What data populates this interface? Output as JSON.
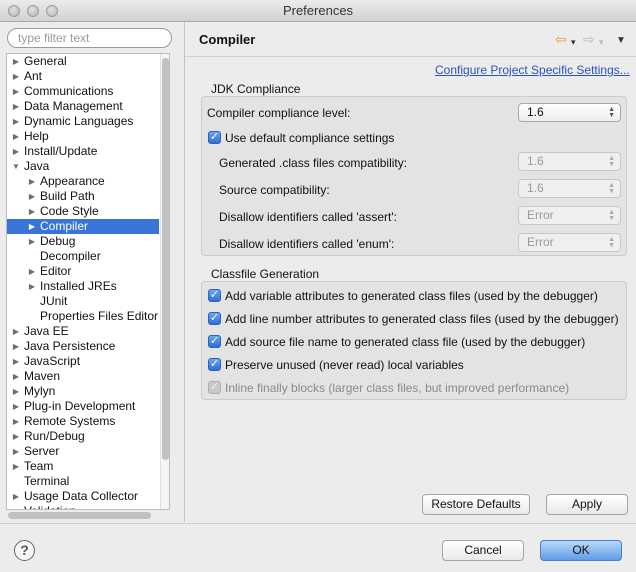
{
  "window": {
    "title": "Preferences"
  },
  "filter": {
    "placeholder": "type filter text"
  },
  "tree": {
    "items": [
      {
        "label": "General",
        "level": 0,
        "expand": "collapsed"
      },
      {
        "label": "Ant",
        "level": 0,
        "expand": "collapsed"
      },
      {
        "label": "Communications",
        "level": 0,
        "expand": "collapsed"
      },
      {
        "label": "Data Management",
        "level": 0,
        "expand": "collapsed"
      },
      {
        "label": "Dynamic Languages",
        "level": 0,
        "expand": "collapsed"
      },
      {
        "label": "Help",
        "level": 0,
        "expand": "collapsed"
      },
      {
        "label": "Install/Update",
        "level": 0,
        "expand": "collapsed"
      },
      {
        "label": "Java",
        "level": 0,
        "expand": "expanded"
      },
      {
        "label": "Appearance",
        "level": 1,
        "expand": "collapsed"
      },
      {
        "label": "Build Path",
        "level": 1,
        "expand": "collapsed"
      },
      {
        "label": "Code Style",
        "level": 1,
        "expand": "collapsed"
      },
      {
        "label": "Compiler",
        "level": 1,
        "expand": "collapsed",
        "selected": true
      },
      {
        "label": "Debug",
        "level": 1,
        "expand": "collapsed"
      },
      {
        "label": "Decompiler",
        "level": 1,
        "expand": "none"
      },
      {
        "label": "Editor",
        "level": 1,
        "expand": "collapsed"
      },
      {
        "label": "Installed JREs",
        "level": 1,
        "expand": "collapsed"
      },
      {
        "label": "JUnit",
        "level": 1,
        "expand": "none"
      },
      {
        "label": "Properties Files Editor",
        "level": 1,
        "expand": "none"
      },
      {
        "label": "Java EE",
        "level": 0,
        "expand": "collapsed"
      },
      {
        "label": "Java Persistence",
        "level": 0,
        "expand": "collapsed"
      },
      {
        "label": "JavaScript",
        "level": 0,
        "expand": "collapsed"
      },
      {
        "label": "Maven",
        "level": 0,
        "expand": "collapsed"
      },
      {
        "label": "Mylyn",
        "level": 0,
        "expand": "collapsed"
      },
      {
        "label": "Plug-in Development",
        "level": 0,
        "expand": "collapsed"
      },
      {
        "label": "Remote Systems",
        "level": 0,
        "expand": "collapsed"
      },
      {
        "label": "Run/Debug",
        "level": 0,
        "expand": "collapsed"
      },
      {
        "label": "Server",
        "level": 0,
        "expand": "collapsed"
      },
      {
        "label": "Team",
        "level": 0,
        "expand": "collapsed"
      },
      {
        "label": "Terminal",
        "level": 0,
        "expand": "none"
      },
      {
        "label": "Usage Data Collector",
        "level": 0,
        "expand": "collapsed"
      },
      {
        "label": "Validation",
        "level": 0,
        "expand": "none"
      }
    ]
  },
  "page": {
    "title": "Compiler",
    "config_link": "Configure Project Specific Settings..."
  },
  "jdk": {
    "group_title": "JDK Compliance",
    "compliance_label": "Compiler compliance level:",
    "compliance_value": "1.6",
    "default_settings_label": "Use default compliance settings",
    "default_settings_checked": true,
    "generated_label": "Generated .class files compatibility:",
    "generated_value": "1.6",
    "source_label": "Source compatibility:",
    "source_value": "1.6",
    "assert_label": "Disallow identifiers called 'assert':",
    "assert_value": "Error",
    "enum_label": "Disallow identifiers called 'enum':",
    "enum_value": "Error"
  },
  "classfile": {
    "group_title": "Classfile Generation",
    "options": [
      {
        "label": "Add variable attributes to generated class files (used by the debugger)",
        "checked": true,
        "enabled": true
      },
      {
        "label": "Add line number attributes to generated class files (used by the debugger)",
        "checked": true,
        "enabled": true
      },
      {
        "label": "Add source file name to generated class file (used by the debugger)",
        "checked": true,
        "enabled": true
      },
      {
        "label": "Preserve unused (never read) local variables",
        "checked": true,
        "enabled": true
      },
      {
        "label": "Inline finally blocks (larger class files, but improved performance)",
        "checked": true,
        "enabled": false
      }
    ]
  },
  "buttons": {
    "restore_defaults": "Restore Defaults",
    "apply": "Apply",
    "cancel": "Cancel",
    "ok": "OK"
  },
  "icons": {
    "help": "?",
    "checkmark": "✓",
    "collapsed": "▶",
    "expanded": "▼",
    "back": "⇦",
    "forward": "⇨",
    "dropdown": "▾",
    "menu": "▼",
    "select_up": "▲",
    "select_down": "▼"
  },
  "colors": {
    "selection": "#3875d7",
    "link": "#2a52be",
    "back_arrow": "#e1a326"
  }
}
